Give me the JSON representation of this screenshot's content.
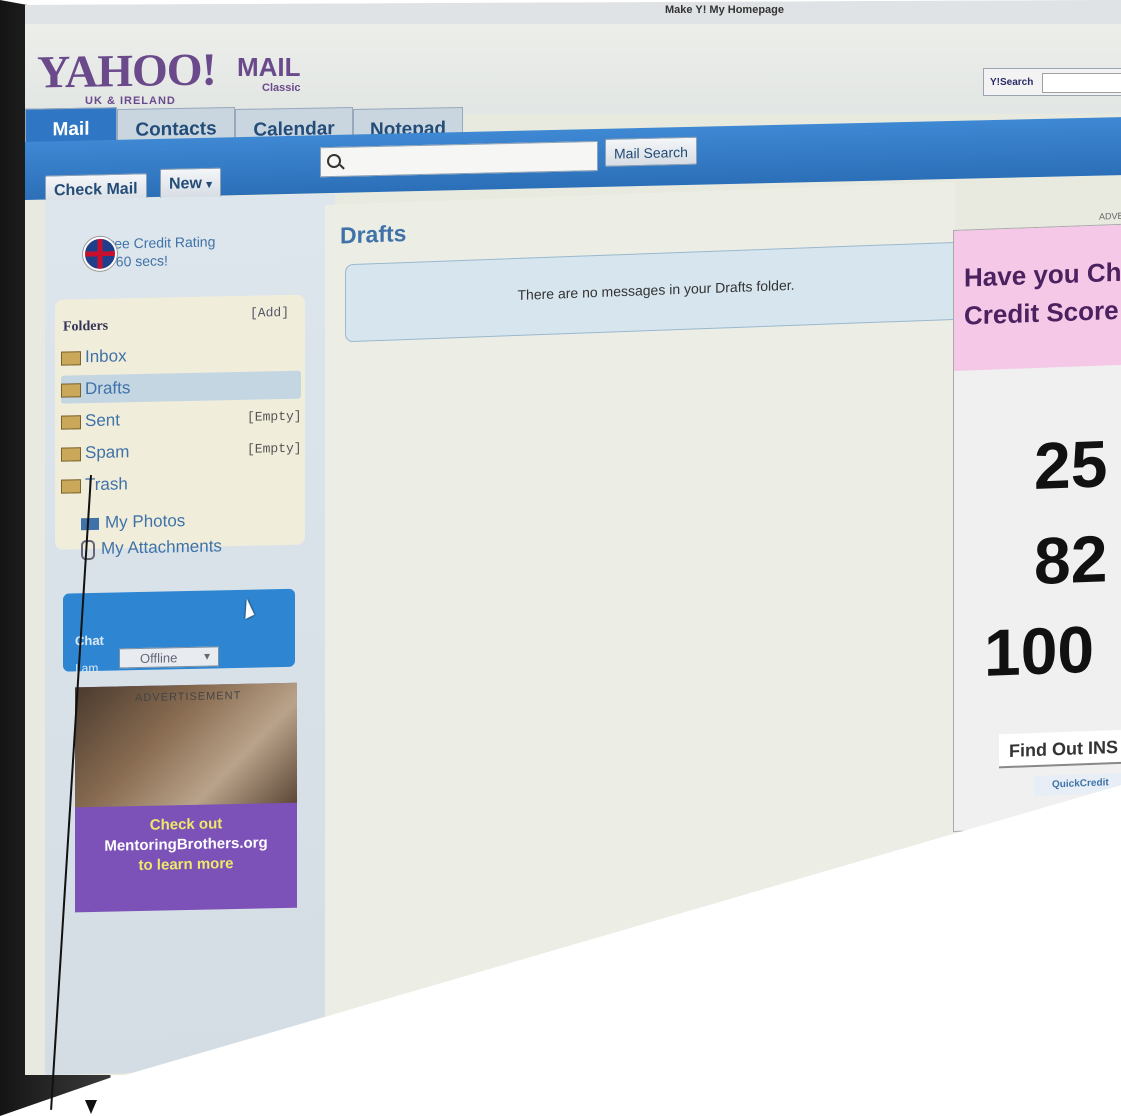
{
  "browser": {
    "make_homepage": "Make Y! My Homepage"
  },
  "header": {
    "logo": "YAHOO!",
    "logo_region": "UK & IRELAND",
    "mail_label": "MAIL",
    "classic_label": "Classic",
    "search_label": "Y!Search"
  },
  "tabs": [
    {
      "label": "Mail",
      "active": true
    },
    {
      "label": "Contacts",
      "active": false
    },
    {
      "label": "Calendar",
      "active": false
    },
    {
      "label": "Notepad",
      "active": false
    }
  ],
  "toolbar": {
    "check_mail": "Check Mail",
    "new": "New",
    "mail_search": "Mail Search"
  },
  "sidebar": {
    "credit_ad_line1": "Free Credit Rating",
    "credit_ad_line2": "in 60 secs!",
    "folders_heading": "Folders",
    "add_link": "[Add]",
    "folders": [
      {
        "label": "Inbox",
        "empty": ""
      },
      {
        "label": "Drafts",
        "empty": "",
        "selected": true
      },
      {
        "label": "Sent",
        "empty": "[Empty]"
      },
      {
        "label": "Spam",
        "empty": "[Empty]"
      },
      {
        "label": "Trash",
        "empty": ""
      }
    ],
    "my_photos": "My Photos",
    "my_attachments": "My Attachments",
    "chat_heading": "Chat",
    "chat_status_label": "I am",
    "chat_status": "Offline",
    "ad_label": "ADVERTISEMENT",
    "ad_line1": "Check out",
    "ad_line2": "MentoringBrothers.org",
    "ad_line3": "to learn more"
  },
  "main": {
    "title": "Drafts",
    "empty_message": "There are no messages in your Drafts folder."
  },
  "right_ad": {
    "label": "ADVERT",
    "headline1": "Have you Ch",
    "headline2": "Credit Score",
    "num1": "25",
    "num2": "82",
    "num3": "100",
    "cta": "Find Out INS",
    "brand": "QuickCredit"
  },
  "colors": {
    "tab_active": "#2f77c4",
    "link_blue": "#3f72a8",
    "ad_purple": "#7d52b8",
    "ad_pink": "#f4c8e6"
  }
}
